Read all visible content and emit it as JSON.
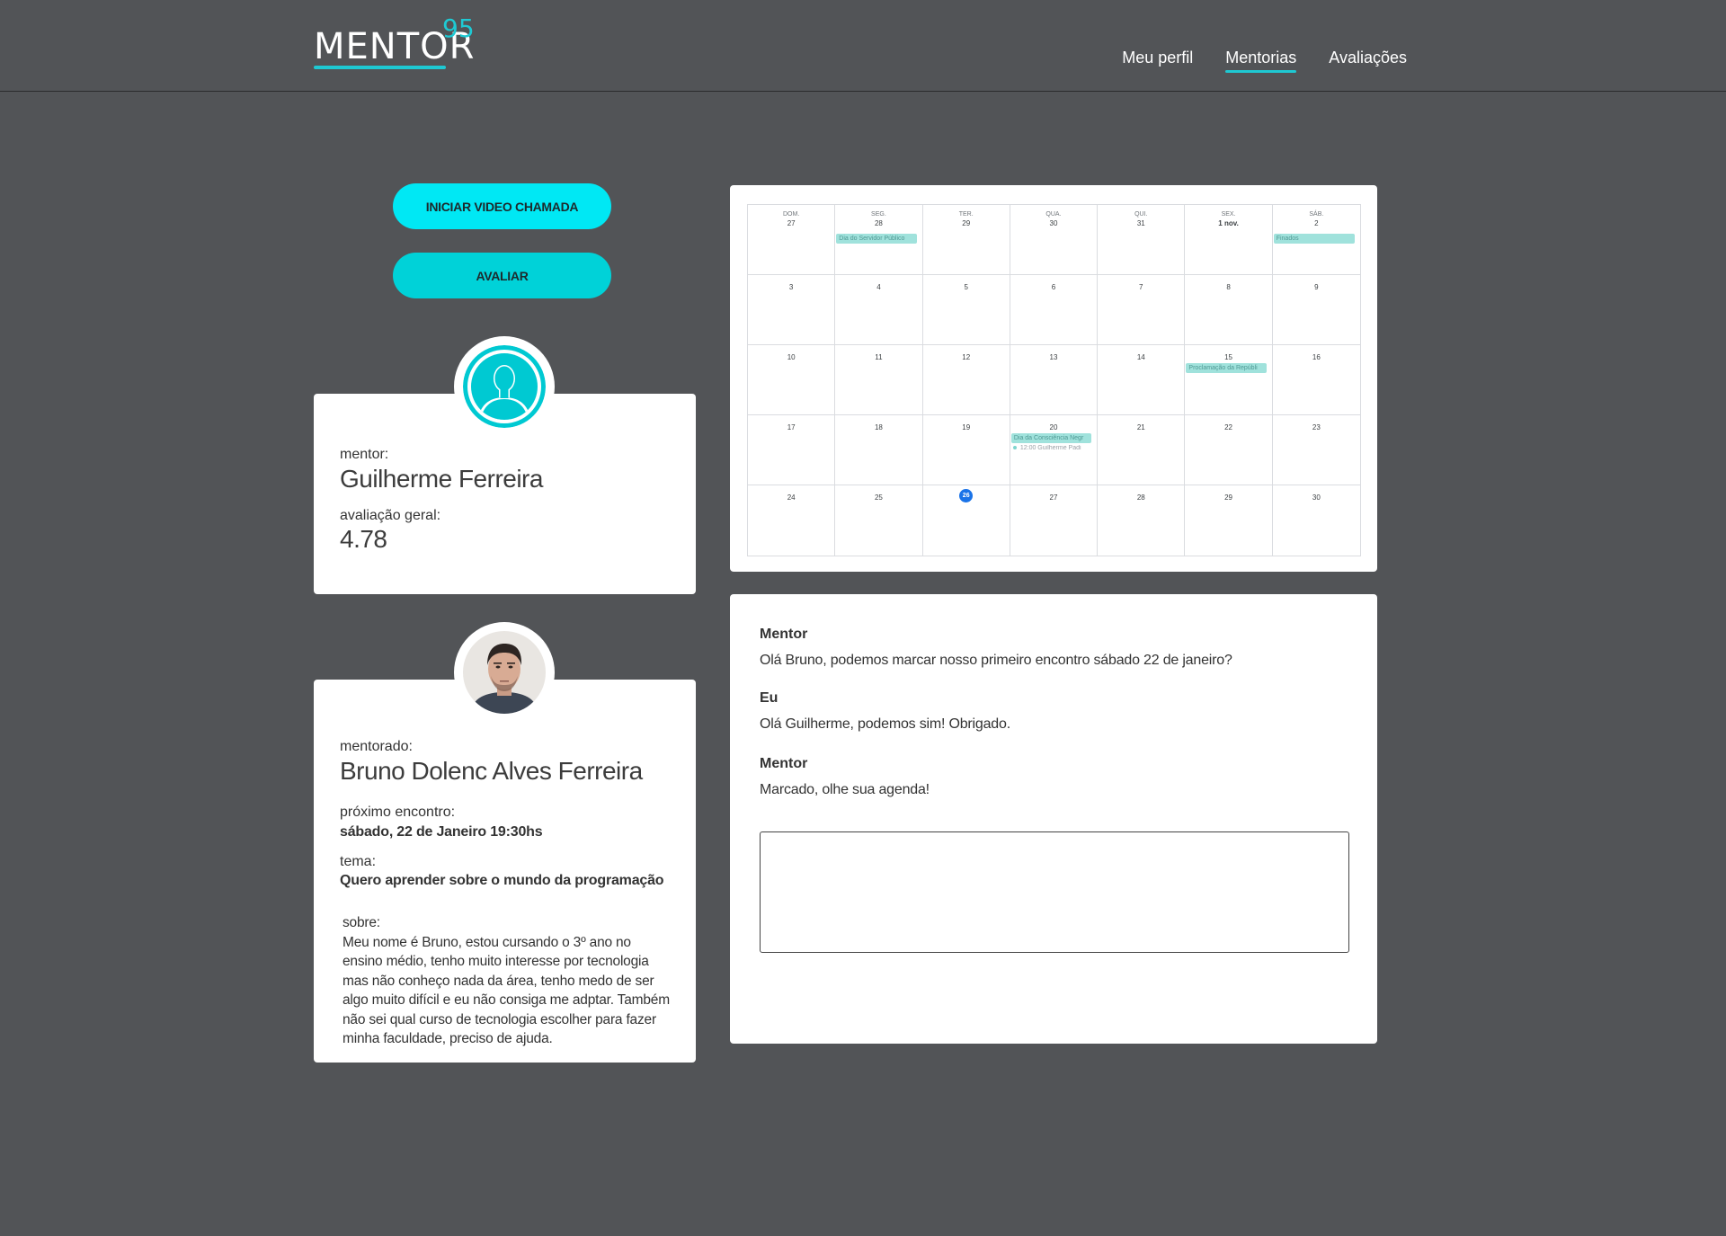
{
  "header": {
    "logo_text": "MENTOR",
    "logo_sup": "95",
    "nav": [
      {
        "label": "Meu perfil",
        "active": false
      },
      {
        "label": "Mentorias",
        "active": true
      },
      {
        "label": "Avaliações",
        "active": false
      }
    ]
  },
  "actions": {
    "video_call_label": "INICIAR VIDEO CHAMADA",
    "rate_label": "AVALIAR"
  },
  "mentor": {
    "role_label": "mentor:",
    "name": "Guilherme Ferreira",
    "rating_label": "avaliação geral:",
    "rating": "4.78",
    "avatar_icon": "person-silhouette-icon"
  },
  "mentee": {
    "role_label": "mentorado:",
    "name": "Bruno Dolenc Alves Ferreira",
    "next_meeting_label": "próximo encontro:",
    "next_meeting": "sábado, 22 de Janeiro 19:30hs",
    "topic_label": "tema:",
    "topic": "Quero aprender sobre o mundo da programação",
    "about_label": "sobre:",
    "about_lines": [
      "Meu nome é Bruno, estou cursando o 3º ano no",
      "ensino médio, tenho muito interesse por tecnologia",
      "mas não conheço nada da área, tenho medo de ser",
      "algo muito difícil e eu não consiga me adptar. Também",
      "não sei qual curso de tecnologia escolher para fazer",
      "minha faculdade, preciso de ajuda."
    ]
  },
  "calendar": {
    "weekdays": [
      "DOM.",
      "SEG.",
      "TER.",
      "QUA.",
      "QUI.",
      "SEX.",
      "SÁB."
    ],
    "weeks": [
      [
        "27",
        "28",
        "29",
        "30",
        "31",
        "1 nov.",
        "2"
      ],
      [
        "3",
        "4",
        "5",
        "6",
        "7",
        "8",
        "9"
      ],
      [
        "10",
        "11",
        "12",
        "13",
        "14",
        "15",
        "16"
      ],
      [
        "17",
        "18",
        "19",
        "20",
        "21",
        "22",
        "23"
      ],
      [
        "24",
        "25",
        "26",
        "27",
        "28",
        "29",
        "30"
      ]
    ],
    "today": "26",
    "events": {
      "w0d1": "Dia do Servidor Público",
      "w0d6": "Finados",
      "w2d5": "Proclamação da Repúbli",
      "w3d3": "Dia da Consciência Negr",
      "w3d3_meeting": "12:00 Guilherme Padi"
    },
    "accent": "#1a73e8",
    "event_color": "#a0e2dc"
  },
  "chat": {
    "messages": [
      {
        "author": "Mentor",
        "text": "Olá Bruno, podemos marcar nosso primeiro encontro sábado 22 de janeiro?"
      },
      {
        "author": "Eu",
        "text": "Olá Guilherme, podemos sim! Obrigado."
      },
      {
        "author": "Mentor",
        "text": "Marcado, olhe sua agenda!"
      }
    ],
    "input_value": ""
  },
  "colors": {
    "background": "#525457",
    "accent": "#1ec9d3",
    "button_primary": "#00e8f4",
    "button_secondary": "#00d2d8"
  }
}
